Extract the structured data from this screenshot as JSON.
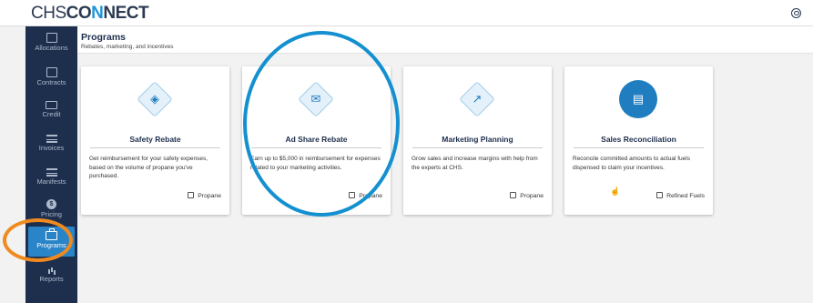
{
  "app": {
    "logo_prefix": "CHS",
    "logo_mid": "CO",
    "logo_n": "N",
    "logo_suffix": "NECT"
  },
  "header": {
    "user_icon": "user-icon"
  },
  "sidebar": {
    "items": [
      {
        "label": "Allocations",
        "icon": "fuel-icon"
      },
      {
        "label": "Contracts",
        "icon": "document-icon"
      },
      {
        "label": "Credit",
        "icon": "credit-card-icon"
      },
      {
        "label": "Invoices",
        "icon": "invoice-icon"
      },
      {
        "label": "Manifests",
        "icon": "manifest-icon"
      },
      {
        "label": "Pricing",
        "icon": "dollar-icon"
      },
      {
        "label": "Programs",
        "icon": "briefcase-icon",
        "active": true
      },
      {
        "label": "Reports",
        "icon": "bar-chart-icon"
      }
    ]
  },
  "page": {
    "title": "Programs",
    "subtitle": "Rebates, marketing, and incentives"
  },
  "cards": [
    {
      "title": "Safety Rebate",
      "icon": "flame-icon",
      "description": "Get reimbursement for your safety expenses, based on the volume of propane you've purchased.",
      "tag": "Propane"
    },
    {
      "title": "Ad Share Rebate",
      "icon": "megaphone-icon",
      "description": "Earn up to $5,000 in reimbursement for expenses related to your marketing activities.",
      "tag": "Propane"
    },
    {
      "title": "Marketing Planning",
      "icon": "trend-chart-icon",
      "description": "Grow sales and increase margins with help from the experts at CHS.",
      "tag": "Propane"
    },
    {
      "title": "Sales Reconciliation",
      "icon": "ledger-icon",
      "description": "Reconcile committed amounts to actual fuels dispensed to claim your incentives.",
      "tag": "Refined Fuels"
    }
  ],
  "colors": {
    "sidebar": "#1e2f4d",
    "accent": "#1f95d6",
    "active": "#2a84c8",
    "ring_orange": "#f08a1e",
    "ring_blue": "#1490d0"
  }
}
